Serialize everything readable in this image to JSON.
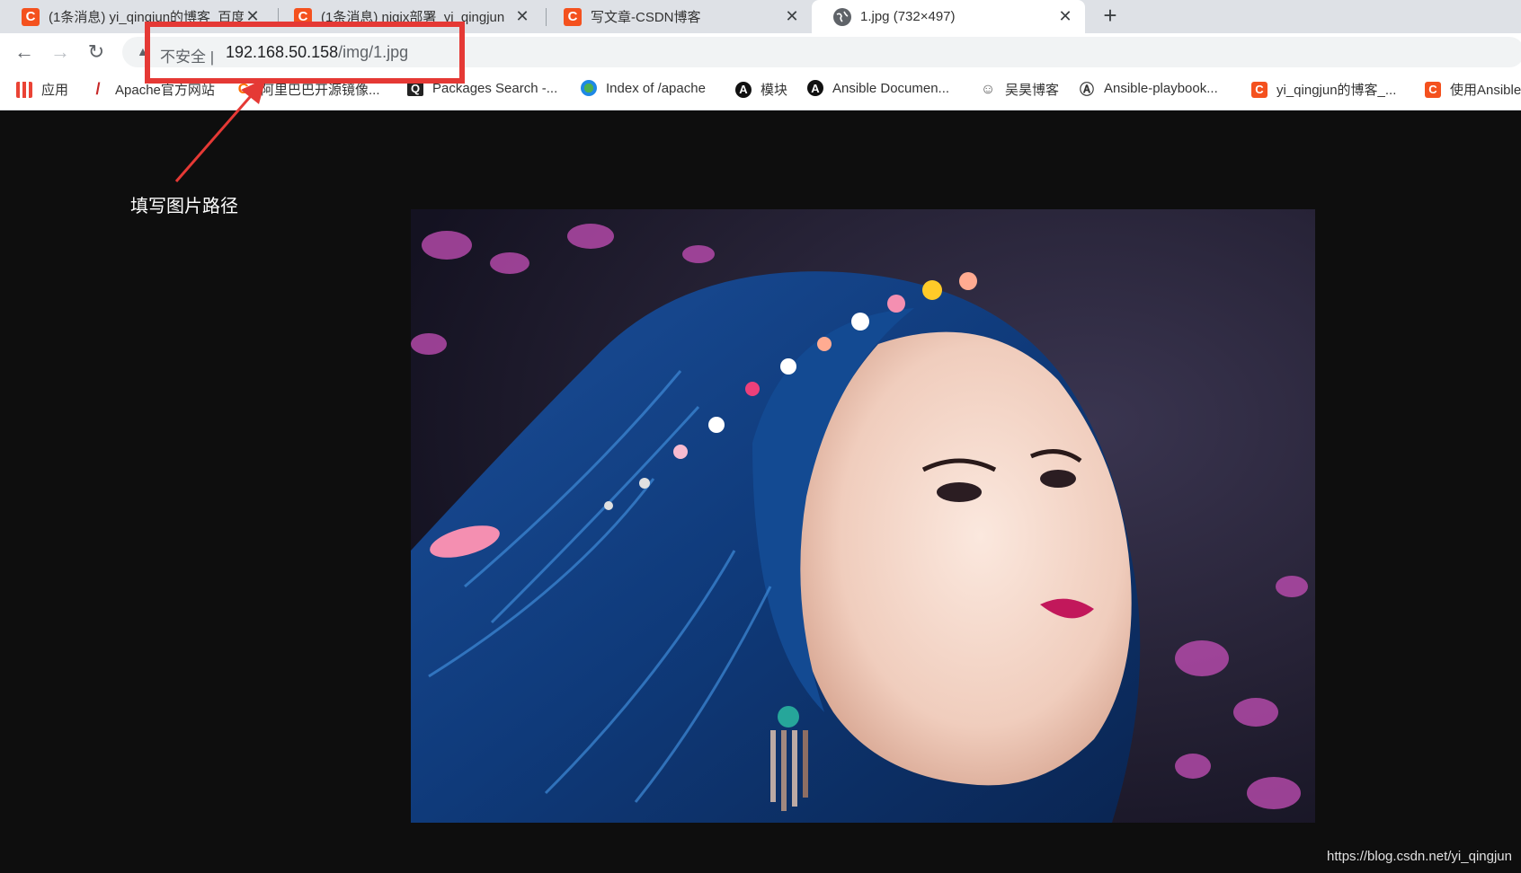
{
  "tabs": [
    {
      "title": "(1条消息) yi_qingjun的博客_百度",
      "icon": "csdn-icon",
      "active": false
    },
    {
      "title": "(1条消息) nigix部署_yi_qingjun",
      "icon": "csdn-icon",
      "active": false
    },
    {
      "title": "写文章-CSDN博客",
      "icon": "csdn-icon",
      "active": false
    },
    {
      "title": "1.jpg (732×497)",
      "icon": "globe-icon",
      "active": true
    }
  ],
  "tab_close_glyph": "✕",
  "new_tab_glyph": "+",
  "nav": {
    "back": "←",
    "forward": "→",
    "reload": "↻"
  },
  "omnibox": {
    "warning_glyph": "▲",
    "security_label": "不安全 |",
    "host": "192.168.50.158",
    "path": "/img/1.jpg"
  },
  "bookmarks": [
    {
      "label": "应用",
      "icon": "apps-grid-icon"
    },
    {
      "label": "Apache官方网站",
      "icon": "apache-feather-icon"
    },
    {
      "label": "阿里巴巴开源镜像...",
      "icon": "aliyun-icon"
    },
    {
      "label": "Packages Search -...",
      "icon": "packages-icon"
    },
    {
      "label": "Index of /apache",
      "icon": "globe-icon"
    },
    {
      "label": "模块",
      "icon": "ansible-icon"
    },
    {
      "label": "Ansible Documen...",
      "icon": "ansible-icon"
    },
    {
      "label": "吴昊博客",
      "icon": "blog-icon"
    },
    {
      "label": "Ansible-playbook...",
      "icon": "ansible-outline-icon"
    },
    {
      "label": "yi_qingjun的博客_...",
      "icon": "csdn-icon"
    },
    {
      "label": "使用Ansible",
      "icon": "csdn-icon"
    }
  ],
  "annotation": {
    "text": "填写图片路径"
  },
  "watermark": "https://blog.csdn.net/yi_qingjun",
  "colors": {
    "highlight_box": "#e53935",
    "csdn": "#f4511e",
    "page_bg": "#0e0e0e"
  }
}
